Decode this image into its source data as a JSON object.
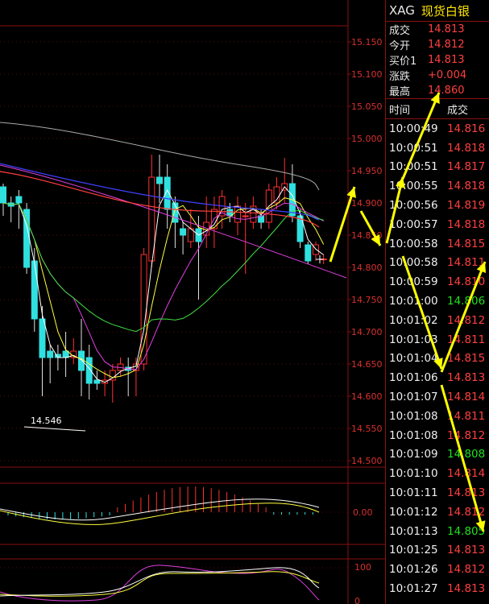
{
  "quote": {
    "symbol": "XAG",
    "name": "现货白银",
    "rows": [
      {
        "label": "成交",
        "value": "14.813"
      },
      {
        "label": "今开",
        "value": "14.812"
      },
      {
        "label": "买价1",
        "value": "14.813"
      },
      {
        "label": "涨跌",
        "value": "+0.004"
      },
      {
        "label": "最高",
        "value": "14.860"
      }
    ]
  },
  "ticks_header": {
    "time": "时间",
    "price": "成交"
  },
  "ticks": [
    {
      "time": "10:00:49",
      "price": "14.816",
      "color": "red"
    },
    {
      "time": "10:00:51",
      "price": "14.818",
      "color": "red"
    },
    {
      "time": "10:00:51",
      "price": "14.817",
      "color": "red"
    },
    {
      "time": "10:00:55",
      "price": "14.818",
      "color": "red"
    },
    {
      "time": "10:00:56",
      "price": "14.819",
      "color": "red"
    },
    {
      "time": "10:00:57",
      "price": "14.818",
      "color": "red"
    },
    {
      "time": "10:00:58",
      "price": "14.815",
      "color": "red"
    },
    {
      "time": "10:00:58",
      "price": "14.811",
      "color": "red"
    },
    {
      "time": "10:00:59",
      "price": "14.810",
      "color": "red"
    },
    {
      "time": "10:01:00",
      "price": "14.806",
      "color": "green"
    },
    {
      "time": "10:01:02",
      "price": "14.812",
      "color": "red"
    },
    {
      "time": "10:01:03",
      "price": "14.811",
      "color": "red"
    },
    {
      "time": "10:01:04",
      "price": "14.815",
      "color": "red"
    },
    {
      "time": "10:01:06",
      "price": "14.813",
      "color": "red"
    },
    {
      "time": "10:01:07",
      "price": "14.814",
      "color": "red"
    },
    {
      "time": "10:01:08",
      "price": "14.811",
      "color": "red"
    },
    {
      "time": "10:01:08",
      "price": "14.812",
      "color": "red"
    },
    {
      "time": "10:01:09",
      "price": "14.808",
      "color": "green"
    },
    {
      "time": "10:01:10",
      "price": "14.814",
      "color": "red"
    },
    {
      "time": "10:01:11",
      "price": "14.813",
      "color": "red"
    },
    {
      "time": "10:01:12",
      "price": "14.812",
      "color": "red"
    },
    {
      "time": "10:01:13",
      "price": "14.805",
      "color": "green"
    },
    {
      "time": "10:01:25",
      "price": "14.813",
      "color": "red"
    },
    {
      "time": "10:01:26",
      "price": "14.812",
      "color": "red"
    },
    {
      "time": "10:01:27",
      "price": "14.813",
      "color": "red"
    }
  ],
  "price_axis": [
    "15.150",
    "15.100",
    "15.050",
    "15.000",
    "14.950",
    "14.900",
    "14.850",
    "14.800",
    "14.750",
    "14.700",
    "14.650",
    "14.600",
    "14.550",
    "14.500"
  ],
  "low_annotation": "14.546",
  "macd_axis": "0.00",
  "kdj_axis_top": "100",
  "kdj_axis_bottom": "0",
  "colors": {
    "up": "#ff3030",
    "down": "#30e0e0",
    "grid": "#8a1010",
    "arrow": "#ffff00"
  },
  "candles": [
    {
      "o": 14.925,
      "c": 14.9,
      "h": 14.93,
      "l": 14.88
    },
    {
      "o": 14.9,
      "c": 14.895,
      "h": 14.91,
      "l": 14.87
    },
    {
      "o": 14.91,
      "c": 14.9,
      "h": 14.92,
      "l": 14.86
    },
    {
      "o": 14.89,
      "c": 14.8,
      "h": 14.9,
      "l": 14.79
    },
    {
      "o": 14.81,
      "c": 14.72,
      "h": 14.83,
      "l": 14.7
    },
    {
      "o": 14.72,
      "c": 14.66,
      "h": 14.74,
      "l": 14.6
    },
    {
      "o": 14.67,
      "c": 14.66,
      "h": 14.68,
      "l": 14.62
    },
    {
      "o": 14.665,
      "c": 14.66,
      "h": 14.68,
      "l": 14.64
    },
    {
      "o": 14.67,
      "c": 14.66,
      "h": 14.7,
      "l": 14.63
    },
    {
      "o": 14.66,
      "c": 14.67,
      "h": 14.69,
      "l": 14.65
    },
    {
      "o": 14.67,
      "c": 14.64,
      "h": 14.72,
      "l": 14.6
    },
    {
      "o": 14.66,
      "c": 14.62,
      "h": 14.68,
      "l": 14.595
    },
    {
      "o": 14.625,
      "c": 14.62,
      "h": 14.64,
      "l": 14.61
    },
    {
      "o": 14.62,
      "c": 14.625,
      "h": 14.64,
      "l": 14.6
    },
    {
      "o": 14.625,
      "c": 14.64,
      "h": 14.65,
      "l": 14.59
    },
    {
      "o": 14.64,
      "c": 14.65,
      "h": 14.66,
      "l": 14.63
    },
    {
      "o": 14.645,
      "c": 14.64,
      "h": 14.66,
      "l": 14.6
    },
    {
      "o": 14.64,
      "c": 14.65,
      "h": 14.66,
      "l": 14.6
    },
    {
      "o": 14.65,
      "c": 14.82,
      "h": 14.83,
      "l": 14.64
    },
    {
      "o": 14.81,
      "c": 14.94,
      "h": 14.975,
      "l": 14.8
    },
    {
      "o": 14.94,
      "c": 14.93,
      "h": 14.975,
      "l": 14.9
    },
    {
      "o": 14.94,
      "c": 14.89,
      "h": 14.96,
      "l": 14.86
    },
    {
      "o": 14.9,
      "c": 14.87,
      "h": 14.91,
      "l": 14.83
    },
    {
      "o": 14.86,
      "c": 14.85,
      "h": 14.87,
      "l": 14.82
    },
    {
      "o": 14.84,
      "c": 14.86,
      "h": 14.89,
      "l": 14.83
    },
    {
      "o": 14.86,
      "c": 14.84,
      "h": 14.88,
      "l": 14.75
    },
    {
      "o": 14.85,
      "c": 14.87,
      "h": 14.91,
      "l": 14.83
    },
    {
      "o": 14.86,
      "c": 14.89,
      "h": 14.91,
      "l": 14.83
    },
    {
      "o": 14.88,
      "c": 14.91,
      "h": 14.92,
      "l": 14.86
    },
    {
      "o": 14.89,
      "c": 14.88,
      "h": 14.9,
      "l": 14.87
    },
    {
      "o": 14.87,
      "c": 14.895,
      "h": 14.91,
      "l": 14.85
    },
    {
      "o": 14.88,
      "c": 14.88,
      "h": 14.9,
      "l": 14.79
    },
    {
      "o": 14.87,
      "c": 14.895,
      "h": 14.91,
      "l": 14.86
    },
    {
      "o": 14.88,
      "c": 14.87,
      "h": 14.89,
      "l": 14.86
    },
    {
      "o": 14.87,
      "c": 14.92,
      "h": 14.93,
      "l": 14.86
    },
    {
      "o": 14.9,
      "c": 14.925,
      "h": 14.94,
      "l": 14.89
    },
    {
      "o": 14.92,
      "c": 14.93,
      "h": 14.97,
      "l": 14.9
    },
    {
      "o": 14.93,
      "c": 14.88,
      "h": 14.96,
      "l": 14.87
    },
    {
      "o": 14.88,
      "c": 14.84,
      "h": 14.89,
      "l": 14.83
    },
    {
      "o": 14.835,
      "c": 14.81,
      "h": 14.84,
      "l": 14.805
    },
    {
      "o": 14.82,
      "c": 14.835,
      "h": 14.84,
      "l": 14.81
    },
    {
      "o": 14.813,
      "c": 14.813,
      "h": 14.82,
      "l": 14.805
    }
  ]
}
